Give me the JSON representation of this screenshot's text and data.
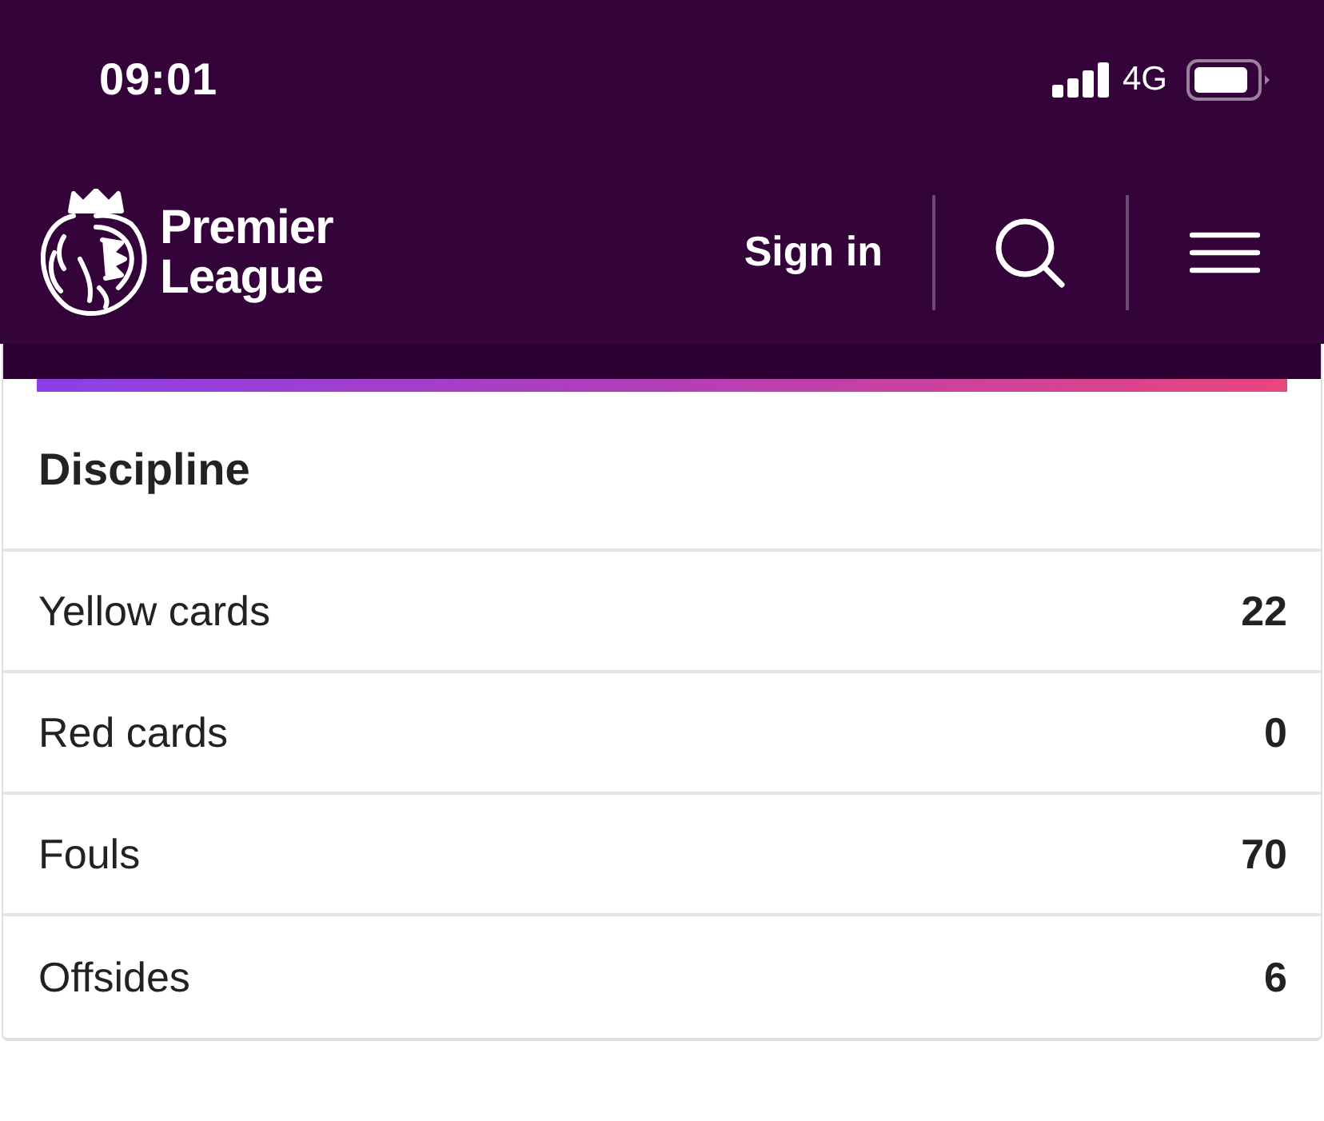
{
  "status_bar": {
    "time": "09:01",
    "network": "4G"
  },
  "nav": {
    "logo_text": "Premier League",
    "sign_in": "Sign in"
  },
  "card": {
    "title": "Discipline",
    "rows": [
      {
        "label": "Yellow cards",
        "value": "22"
      },
      {
        "label": "Red cards",
        "value": "0"
      },
      {
        "label": "Fouls",
        "value": "70"
      },
      {
        "label": "Offsides",
        "value": "6"
      }
    ]
  }
}
